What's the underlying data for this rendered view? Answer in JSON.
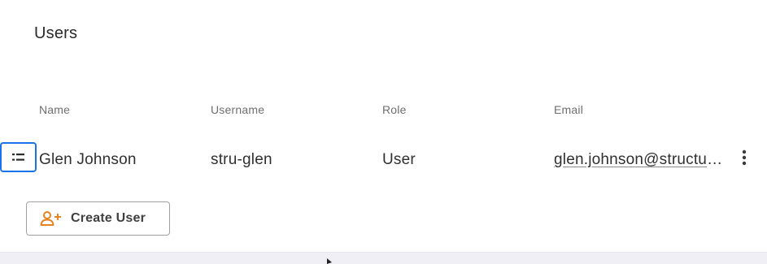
{
  "page": {
    "title": "Users"
  },
  "table": {
    "headers": {
      "name": "Name",
      "username": "Username",
      "role": "Role",
      "email": "Email"
    },
    "rows": [
      {
        "name": "Glen Johnson",
        "username": "stru-glen",
        "role": "User",
        "email": "glen.johnson@structure.com"
      }
    ]
  },
  "actions": {
    "create_user_label": "Create User"
  },
  "icons": {
    "row_handle": "list-icon",
    "row_menu": "more-vertical-icon",
    "create_user": "user-plus-icon"
  },
  "colors": {
    "accent": "#1a73e8",
    "create_icon": "#e8821e"
  }
}
